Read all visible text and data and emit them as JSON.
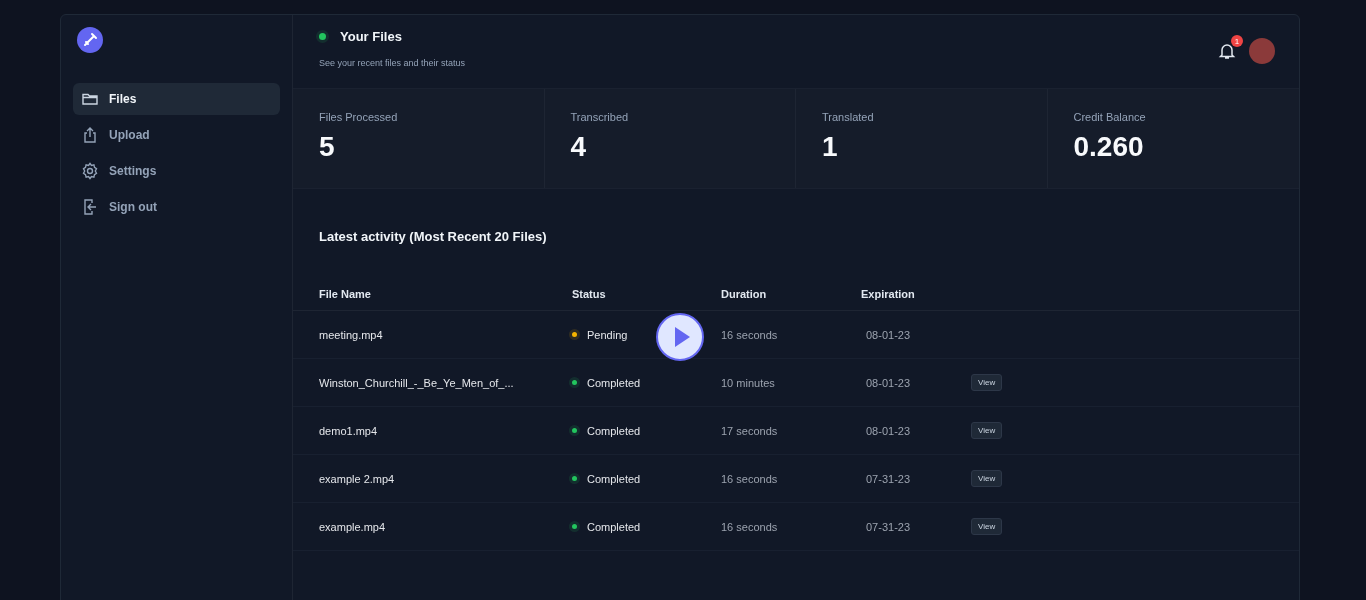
{
  "sidebar": {
    "items": [
      {
        "label": "Files",
        "selected": true
      },
      {
        "label": "Upload",
        "selected": false
      },
      {
        "label": "Settings",
        "selected": false
      },
      {
        "label": "Sign out",
        "selected": false
      }
    ]
  },
  "header": {
    "title": "Your Files",
    "subtitle": "See your recent files and their status",
    "notification_count": "1"
  },
  "stats": [
    {
      "label": "Files Processed",
      "value": "5"
    },
    {
      "label": "Transcribed",
      "value": "4"
    },
    {
      "label": "Translated",
      "value": "1"
    },
    {
      "label": "Credit Balance",
      "value": "0.260"
    }
  ],
  "activity": {
    "title": "Latest activity (Most Recent 20 Files)",
    "columns": [
      "File Name",
      "Status",
      "Duration",
      "Expiration"
    ],
    "rows": [
      {
        "file": "meeting.mp4",
        "status": "Pending",
        "color": "#f5b400",
        "duration": "16 seconds",
        "expiration": "08-01-23"
      },
      {
        "file": "Winston_Churchill_-_Be_Ye_Men_of_...",
        "status": "Completed",
        "color": "#22c55e",
        "duration": "10 minutes",
        "expiration": "08-01-23",
        "action": "View"
      },
      {
        "file": "demo1.mp4",
        "status": "Completed",
        "color": "#22c55e",
        "duration": "17 seconds",
        "expiration": "08-01-23",
        "action": "View"
      },
      {
        "file": "example 2.mp4",
        "status": "Completed",
        "color": "#22c55e",
        "duration": "16 seconds",
        "expiration": "07-31-23",
        "action": "View"
      },
      {
        "file": "example.mp4",
        "status": "Completed",
        "color": "#22c55e",
        "duration": "16 seconds",
        "expiration": "07-31-23",
        "action": "View"
      }
    ]
  }
}
